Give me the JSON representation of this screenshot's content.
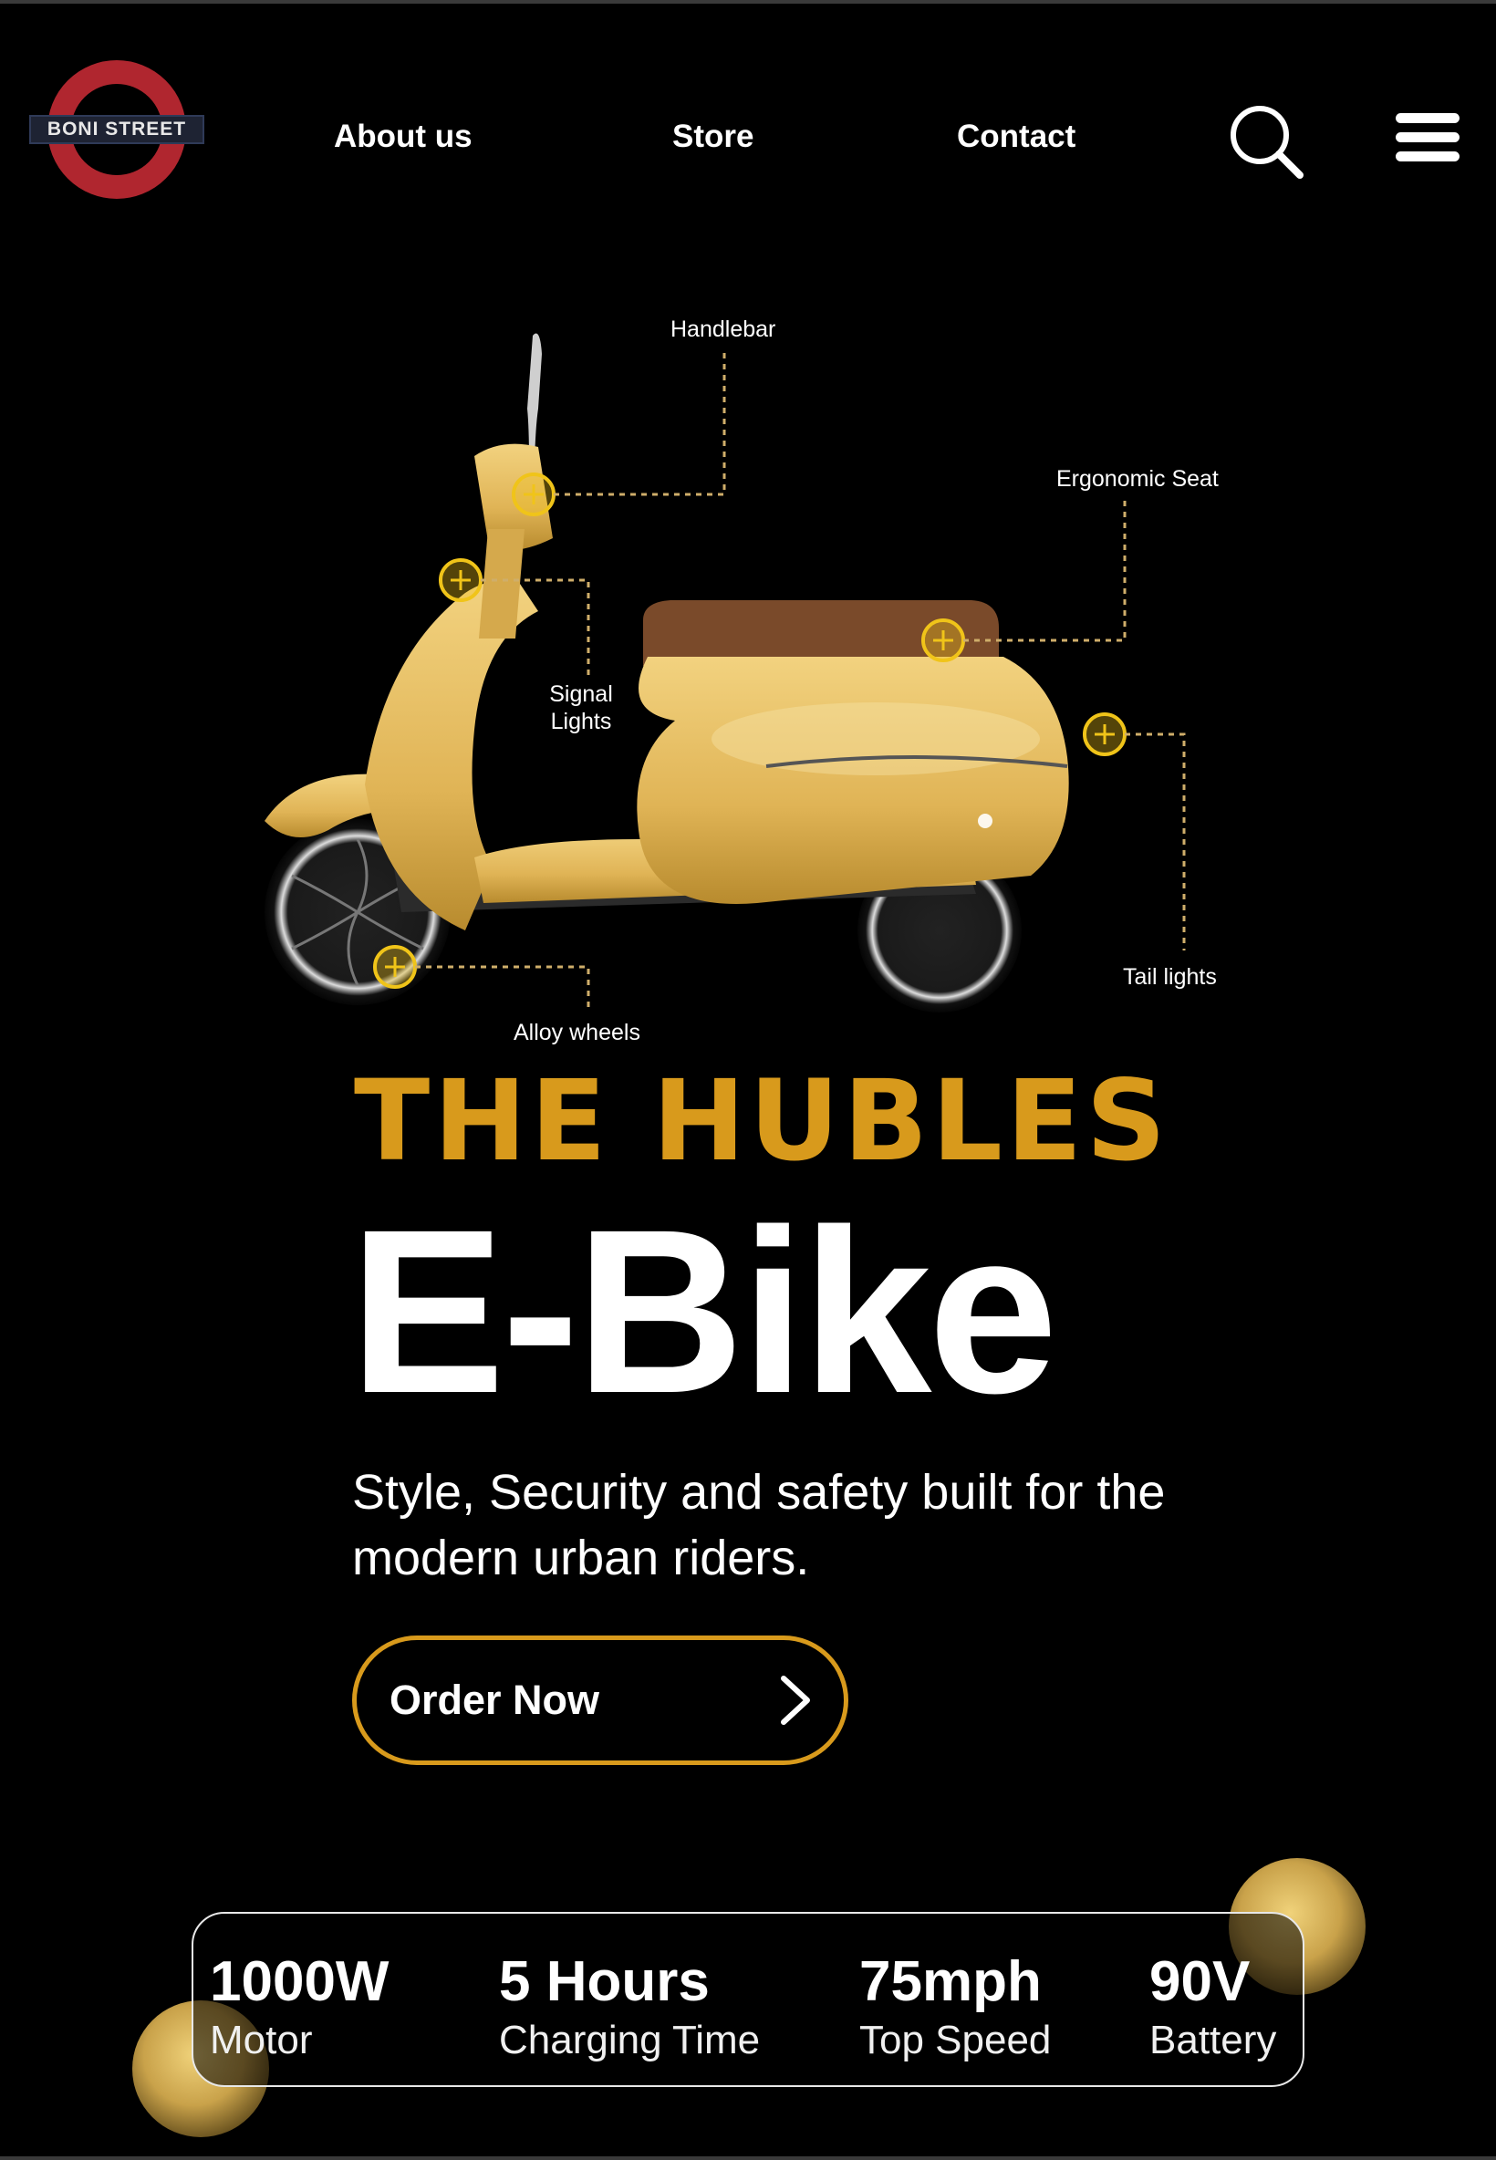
{
  "header": {
    "logo_text": "BONI STREET",
    "nav": {
      "about": "About us",
      "store": "Store",
      "contact": "Contact"
    },
    "icons": [
      "search-icon",
      "hamburger-menu-icon"
    ]
  },
  "illustration": {
    "callouts": {
      "handlebar": "Handlebar",
      "ergonomic_seat": "Ergonomic Seat",
      "signal_lights_1": "Signal",
      "signal_lights_2": "Lights",
      "tail_lights": "Tail lights",
      "alloy_wheels": "Alloy wheels"
    }
  },
  "hero": {
    "brand": "THE HUBLES",
    "headline": "E-Bike",
    "tagline_line1": "Style, Security and safety built for the",
    "tagline_line2": "modern urban riders.",
    "cta_label": "Order Now"
  },
  "stats": [
    {
      "value": "1000W",
      "label": "Motor"
    },
    {
      "value": "5 Hours",
      "label": "Charging Time"
    },
    {
      "value": "75mph",
      "label": "Top Speed"
    },
    {
      "value": "90V",
      "label": "Battery"
    }
  ],
  "colors": {
    "accent": "#d89a1c",
    "background": "#000000",
    "scooter_body": "#e6bd5e",
    "seat": "#7a4a2a",
    "logo_ring": "#b0262f"
  }
}
